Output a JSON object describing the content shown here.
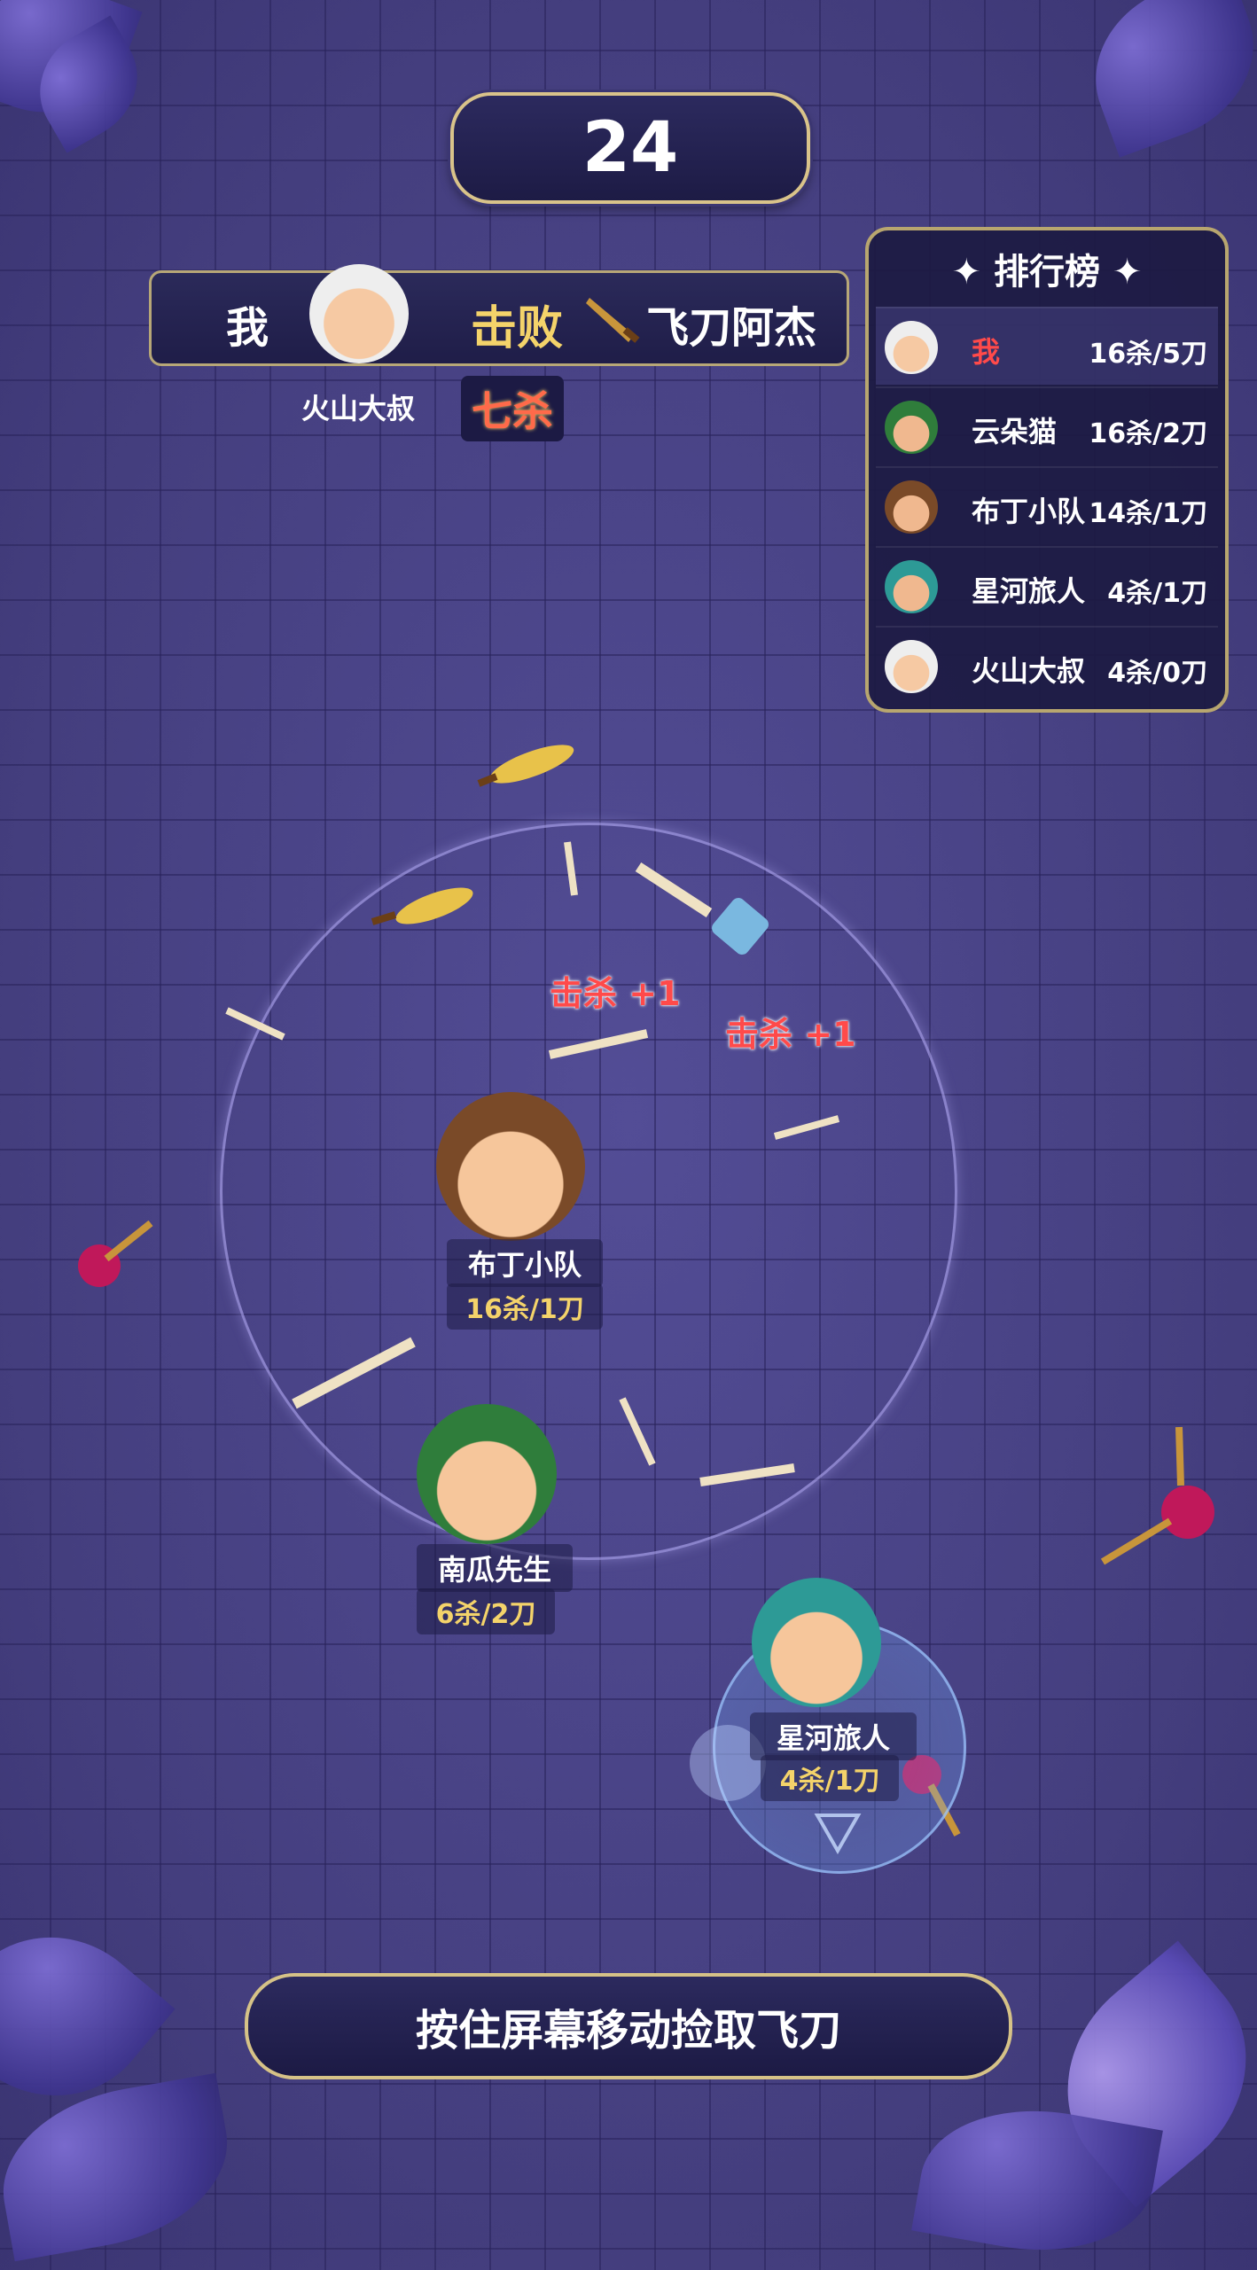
{
  "timer": "24",
  "kill_banner": {
    "killer": "我",
    "action": "击败",
    "victim": "飞刀阿杰",
    "sub_name": "火山大叔",
    "streak_badge": "七杀"
  },
  "leaderboard": {
    "title": "排行榜",
    "rows": [
      {
        "name": "我",
        "score": "16杀/5刀",
        "highlight": true
      },
      {
        "name": "云朵猫",
        "score": "16杀/2刀"
      },
      {
        "name": "布丁小队",
        "score": "14杀/1刀"
      },
      {
        "name": "星河旅人",
        "score": "4杀/1刀"
      },
      {
        "name": "火山大叔",
        "score": "4杀/0刀"
      }
    ]
  },
  "kill_popups": [
    "击杀 +1",
    "击杀 +1"
  ],
  "players": [
    {
      "name": "布丁小队",
      "score": "16杀/1刀"
    },
    {
      "name": "南瓜先生",
      "score": "6杀/2刀"
    },
    {
      "name": "星河旅人",
      "score": "4杀/1刀"
    }
  ],
  "hint": "按住屏幕移动捡取飞刀",
  "colors": {
    "accent_gold": "#f4d36a",
    "highlight_red": "#ff4a4a",
    "panel": "#1f1d48"
  }
}
